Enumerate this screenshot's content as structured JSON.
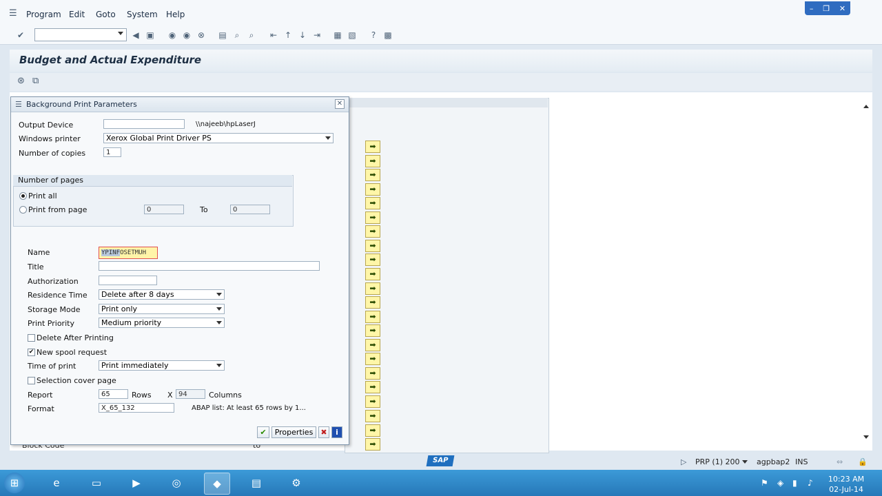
{
  "menu": {
    "items": [
      "Program",
      "Edit",
      "Goto",
      "System",
      "Help"
    ]
  },
  "window_controls": {
    "minimize": "–",
    "restore": "❐",
    "close": "✕"
  },
  "toolbar": {
    "command_field": ""
  },
  "page": {
    "title": "Budget and Actual  Expenditure"
  },
  "background_screen": {
    "block_code_label": "Block Code",
    "to_label": "to"
  },
  "dialog": {
    "title": "Background Print Parameters",
    "output_device": {
      "label": "Output Device",
      "value": "",
      "printer_path": "\\\\najeeb\\hpLaserJ"
    },
    "windows_printer": {
      "label": "Windows printer",
      "value": "Xerox Global Print Driver PS"
    },
    "copies": {
      "label": "Number of copies",
      "value": "1"
    },
    "pages": {
      "header": "Number of pages",
      "print_all": "Print all",
      "print_from": "Print from page",
      "from_value": "0",
      "to_label": "To",
      "to_value": "0"
    },
    "name": {
      "label": "Name",
      "value_selected": "YPINF",
      "value_rest": "OSETMUH"
    },
    "title_field": {
      "label": "Title",
      "value": ""
    },
    "authorization": {
      "label": "Authorization",
      "value": ""
    },
    "residence_time": {
      "label": "Residence Time",
      "value": "Delete after 8 days"
    },
    "storage_mode": {
      "label": "Storage Mode",
      "value": "Print only"
    },
    "print_priority": {
      "label": "Print Priority",
      "value": "Medium priority"
    },
    "delete_after_printing": {
      "label": "Delete After Printing",
      "checked": false
    },
    "new_spool_request": {
      "label": "New spool request",
      "checked": true
    },
    "time_of_print": {
      "label": "Time of print",
      "value": "Print immediately"
    },
    "selection_cover_page": {
      "label": "Selection cover page",
      "checked": false
    },
    "report": {
      "label": "Report",
      "rows": "65",
      "rows_label": "Rows",
      "x_label": "X",
      "columns": "94",
      "columns_label": "Columns"
    },
    "format": {
      "label": "Format",
      "value": "X_65_132",
      "description": "ABAP list: At least 65 rows by 1..."
    },
    "buttons": {
      "properties": "Properties"
    }
  },
  "status_bar": {
    "sap_logo": "SAP",
    "system": "PRP (1) 200",
    "server": "agpbap2",
    "mode": "INS"
  },
  "taskbar": {
    "time": "10:23 AM",
    "date": "02-Jul-14"
  }
}
